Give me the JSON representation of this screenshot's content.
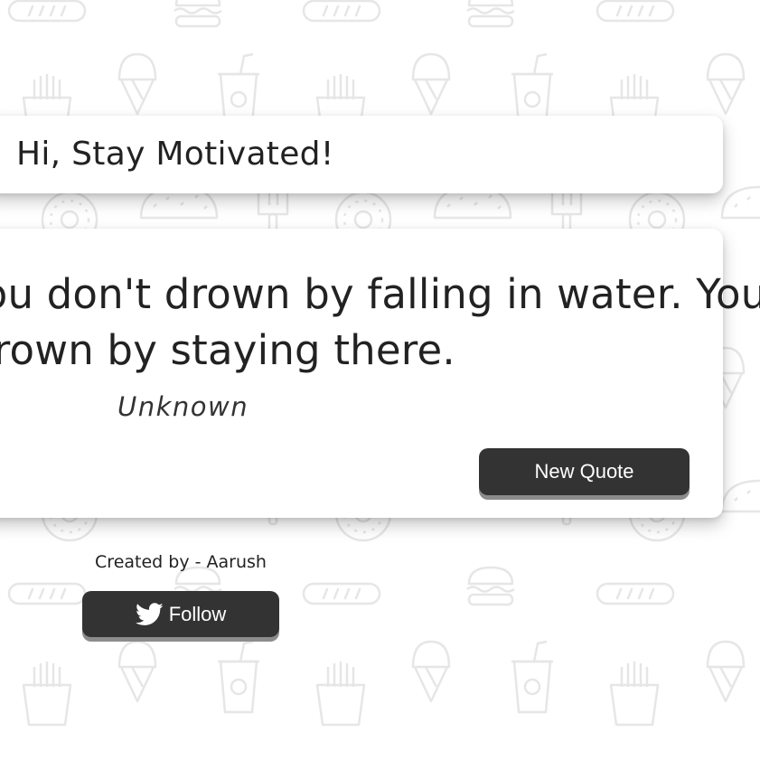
{
  "header": {
    "greeting": "Hi, Stay Motivated!"
  },
  "quote": {
    "line1": "You don't drown by falling in water. You",
    "line2": "drown by staying there.",
    "author": "Unknown",
    "new_quote_label": "New Quote"
  },
  "footer": {
    "credit": "Created by - Aarush",
    "follow_label": "Follow",
    "follow_icon": "twitter-bird-icon"
  },
  "background": {
    "pattern_icons": [
      "hotdog-icon",
      "burger-icon",
      "fries-icon",
      "ice-cream-icon",
      "soda-cup-icon",
      "donut-icon",
      "taco-icon",
      "popsicle-icon"
    ]
  },
  "colors": {
    "button_bg": "#333333",
    "button_shadow": "#8c8c8c",
    "text": "#222222",
    "pattern": "#e6e6e6"
  }
}
